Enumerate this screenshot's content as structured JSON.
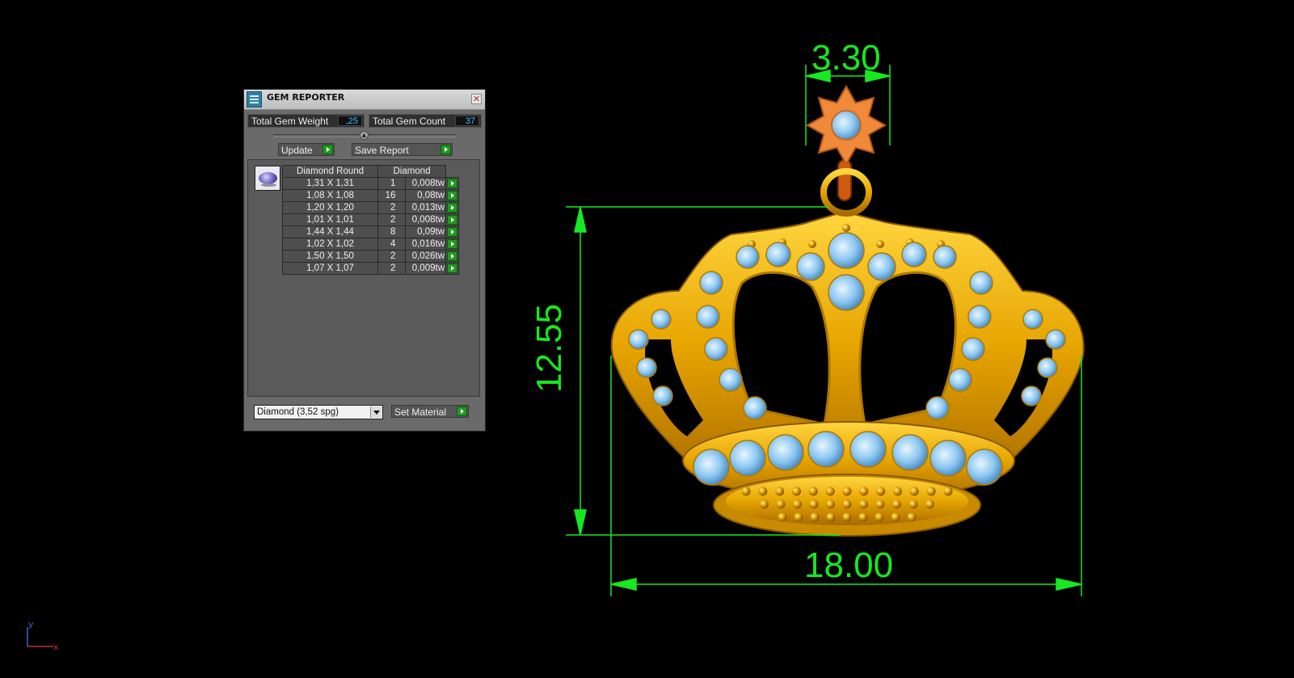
{
  "gem_reporter": {
    "title": "GEM REPORTER",
    "close_glyph": "✕",
    "total_weight_label": "Total Gem Weight",
    "total_weight_value": ",25",
    "total_count_label": "Total Gem Count",
    "total_count_value": "37",
    "update_label": "Update",
    "save_report_label": "Save Report",
    "table_headers": [
      "Diamond Round",
      "Diamond"
    ],
    "rows": [
      {
        "size": "1,31 X 1,31",
        "qty": "1",
        "weight": "0,008tw"
      },
      {
        "size": "1,08 X 1,08",
        "qty": "16",
        "weight": "0,08tw"
      },
      {
        "size": "1,20 X 1,20",
        "qty": "2",
        "weight": "0,013tw"
      },
      {
        "size": "1,01 X 1,01",
        "qty": "2",
        "weight": "0,008tw"
      },
      {
        "size": "1,44 X 1,44",
        "qty": "8",
        "weight": "0,09tw"
      },
      {
        "size": "1,02 X 1,02",
        "qty": "4",
        "weight": "0,016tw"
      },
      {
        "size": "1,50 X 1,50",
        "qty": "2",
        "weight": "0,026tw"
      },
      {
        "size": "1,07 X 1,07",
        "qty": "2",
        "weight": "0,009tw"
      }
    ],
    "material_select": "Diamond    (3,52 spg)",
    "set_material_label": "Set Material"
  },
  "dimensions": {
    "top_width": "3.30",
    "height": "12.55",
    "width": "18.00",
    "color": "#17e81f"
  },
  "axes": {
    "y": "y",
    "x": "x"
  },
  "colors": {
    "gold": "#e8a800",
    "gem": "#8ec8f2",
    "bail_star": "#f08a3a",
    "panel": "#6a6a6a"
  }
}
